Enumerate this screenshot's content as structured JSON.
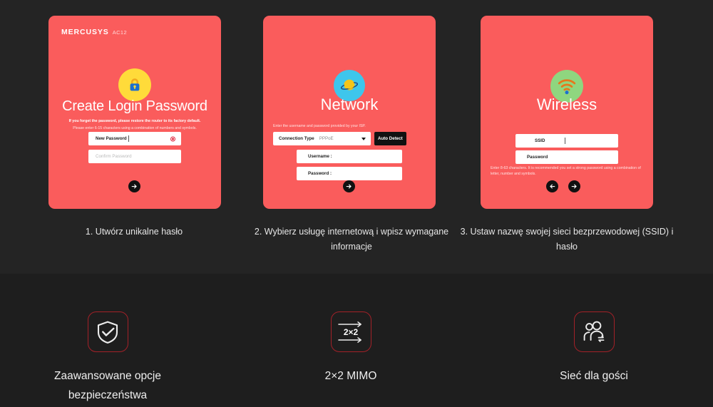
{
  "theme": {
    "page_bg": "#222222",
    "features_bg": "#1e1e1e",
    "card_red": "#fa5c5c",
    "accent_border": "#a32128"
  },
  "setup": {
    "cards": [
      {
        "brand_name": "MERCUSYS",
        "brand_model": "AC12",
        "icon": "padlock-icon",
        "title": "Create Login Password",
        "hint_bold": "If you forget the password, please restore the router to its factory default.",
        "hint": "Please enter 6-15 characters using a combination of numbers and symbols.",
        "fields": [
          {
            "label": "New Password",
            "value": "",
            "placeholder": "",
            "has_clear": true
          },
          {
            "label": "",
            "value": "",
            "placeholder": "Confirm Password",
            "has_clear": false
          }
        ],
        "nav": [
          "next-arrow"
        ]
      },
      {
        "icon": "globe-planet-icon",
        "title": "Network",
        "hint": "Enter the username and password provided by your ISP.",
        "connection_type_label": "Connection Type",
        "connection_type_value": "PPPoE",
        "auto_detect_label": "Auto Detect",
        "fields": [
          {
            "label": "Username :",
            "value": "",
            "placeholder": "",
            "has_clear": false
          },
          {
            "label": "Password :",
            "value": "",
            "placeholder": "",
            "has_clear": false
          }
        ],
        "nav": [
          "next-arrow"
        ]
      },
      {
        "icon": "wifi-icon",
        "title": "Wireless",
        "hint": "Enter 8-63 characters. It is recommended you set a strong password using a combination of letter, number and symbols.",
        "fields": [
          {
            "label": "SSID",
            "value": "",
            "placeholder": "",
            "has_clear": false
          },
          {
            "label": "Password",
            "value": "",
            "placeholder": "",
            "has_clear": false
          }
        ],
        "nav": [
          "back-arrow",
          "next-arrow"
        ]
      }
    ],
    "captions": [
      "1. Utwórz unikalne hasło",
      "2. Wybierz usługę internetową i wpisz wymagane informacje",
      "3. Ustaw nazwę swojej sieci bezprzewodowej (SSID) i hasło"
    ]
  },
  "features": [
    {
      "icon": "shield-check-icon",
      "label": "Zaawansowane opcje bezpieczeństwa"
    },
    {
      "icon": "mimo-arrows-icon",
      "label": "2×2 MIMO",
      "icon_text": "2×2"
    },
    {
      "icon": "guest-users-icon",
      "label": "Sieć dla gości"
    }
  ]
}
